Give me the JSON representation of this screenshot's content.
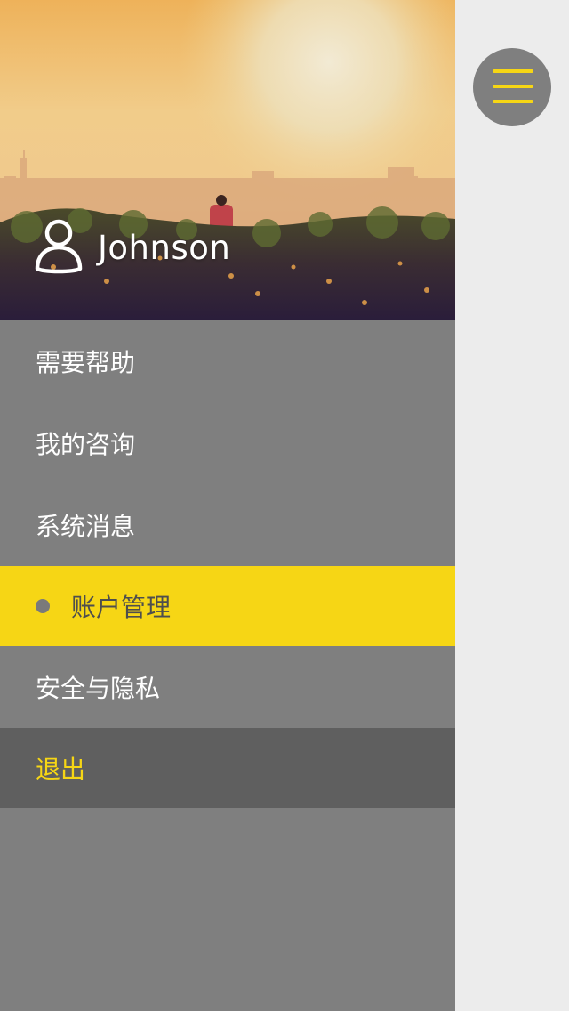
{
  "header": {
    "username": "Johnson"
  },
  "menu": {
    "items": [
      {
        "label": "需要帮助"
      },
      {
        "label": "我的咨询"
      },
      {
        "label": "系统消息"
      },
      {
        "label": "账户管理"
      },
      {
        "label": "安全与隐私"
      },
      {
        "label": "退出"
      }
    ],
    "active_index": 3
  },
  "colors": {
    "accent": "#f6d615",
    "drawer_bg": "#7f7f7f",
    "logout_bg": "#5f5f5f",
    "page_bg": "#ececec"
  },
  "icons": {
    "user": "user-outline-icon",
    "menu": "hamburger-menu-icon"
  }
}
